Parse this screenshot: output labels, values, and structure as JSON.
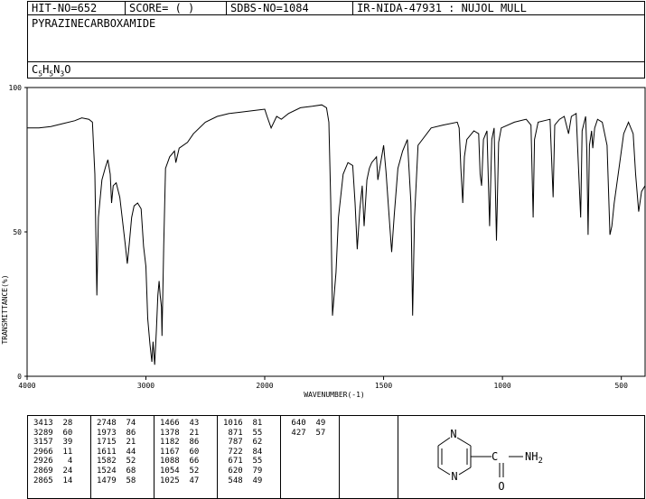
{
  "header": {
    "hit": "HIT-NO=652",
    "score": "SCORE=  (   )",
    "sdbs": "SDBS-NO=1084",
    "ir": "IR-NIDA-47931 : NUJOL MULL"
  },
  "compound": {
    "name": "PYRAZINECARBOXAMIDE",
    "formula": {
      "c": "C",
      "c_n": "5",
      "h": "H",
      "h_n": "5",
      "n": "N",
      "n_n": "3",
      "o": "O"
    }
  },
  "chart_data": {
    "type": "line",
    "xlabel": "WAVENUMBER(-1)",
    "ylabel": "TRANSMITTANCE(%)",
    "xlim": [
      4000,
      400
    ],
    "ylim": [
      0,
      100
    ],
    "xticks": [
      "4000",
      "3000",
      "2000",
      "1500",
      "1000",
      "500"
    ],
    "yticks": [
      "100",
      "50",
      "0"
    ],
    "series": [
      {
        "points": [
          [
            4000,
            86
          ],
          [
            3900,
            86
          ],
          [
            3800,
            86.5
          ],
          [
            3700,
            87.5
          ],
          [
            3600,
            88.5
          ],
          [
            3540,
            89.5
          ],
          [
            3480,
            89
          ],
          [
            3450,
            88
          ],
          [
            3430,
            70
          ],
          [
            3413,
            28
          ],
          [
            3400,
            55
          ],
          [
            3370,
            68
          ],
          [
            3340,
            72.5
          ],
          [
            3320,
            75
          ],
          [
            3300,
            70
          ],
          [
            3289,
            60
          ],
          [
            3275,
            66
          ],
          [
            3250,
            67
          ],
          [
            3220,
            62
          ],
          [
            3200,
            55
          ],
          [
            3175,
            46
          ],
          [
            3157,
            39
          ],
          [
            3140,
            46
          ],
          [
            3120,
            55
          ],
          [
            3100,
            59
          ],
          [
            3070,
            60
          ],
          [
            3040,
            58
          ],
          [
            3020,
            45
          ],
          [
            3000,
            38
          ],
          [
            2985,
            20
          ],
          [
            2966,
            11
          ],
          [
            2950,
            5
          ],
          [
            2940,
            12
          ],
          [
            2926,
            4
          ],
          [
            2912,
            16
          ],
          [
            2900,
            28
          ],
          [
            2889,
            33
          ],
          [
            2880,
            28
          ],
          [
            2869,
            24
          ],
          [
            2865,
            14
          ],
          [
            2850,
            45
          ],
          [
            2835,
            72
          ],
          [
            2800,
            76
          ],
          [
            2760,
            78
          ],
          [
            2748,
            74
          ],
          [
            2720,
            79
          ],
          [
            2650,
            81
          ],
          [
            2600,
            84
          ],
          [
            2500,
            88
          ],
          [
            2400,
            90
          ],
          [
            2300,
            91
          ],
          [
            2200,
            91.5
          ],
          [
            2100,
            92
          ],
          [
            2000,
            92.5
          ],
          [
            1990,
            90
          ],
          [
            1973,
            86
          ],
          [
            1950,
            90
          ],
          [
            1930,
            89
          ],
          [
            1900,
            91
          ],
          [
            1850,
            93
          ],
          [
            1800,
            93.5
          ],
          [
            1760,
            94
          ],
          [
            1740,
            93
          ],
          [
            1730,
            88
          ],
          [
            1722,
            60
          ],
          [
            1715,
            21
          ],
          [
            1700,
            36
          ],
          [
            1690,
            55
          ],
          [
            1670,
            70
          ],
          [
            1650,
            74
          ],
          [
            1630,
            73
          ],
          [
            1620,
            60
          ],
          [
            1611,
            44
          ],
          [
            1600,
            58
          ],
          [
            1590,
            66
          ],
          [
            1582,
            52
          ],
          [
            1570,
            68
          ],
          [
            1560,
            72
          ],
          [
            1550,
            74
          ],
          [
            1530,
            76
          ],
          [
            1524,
            68
          ],
          [
            1510,
            75
          ],
          [
            1500,
            80
          ],
          [
            1490,
            71
          ],
          [
            1479,
            58
          ],
          [
            1466,
            43
          ],
          [
            1455,
            56
          ],
          [
            1440,
            72
          ],
          [
            1420,
            78
          ],
          [
            1400,
            82
          ],
          [
            1385,
            60
          ],
          [
            1378,
            21
          ],
          [
            1370,
            55
          ],
          [
            1355,
            80
          ],
          [
            1300,
            86
          ],
          [
            1250,
            87
          ],
          [
            1190,
            88
          ],
          [
            1182,
            86
          ],
          [
            1175,
            72
          ],
          [
            1167,
            60
          ],
          [
            1160,
            76
          ],
          [
            1150,
            82
          ],
          [
            1120,
            85
          ],
          [
            1100,
            84
          ],
          [
            1094,
            70
          ],
          [
            1088,
            66
          ],
          [
            1080,
            82
          ],
          [
            1065,
            85
          ],
          [
            1054,
            52
          ],
          [
            1045,
            82
          ],
          [
            1035,
            86
          ],
          [
            1025,
            47
          ],
          [
            1016,
            81
          ],
          [
            1005,
            86
          ],
          [
            950,
            88
          ],
          [
            900,
            89
          ],
          [
            880,
            87
          ],
          [
            871,
            55
          ],
          [
            865,
            82
          ],
          [
            850,
            88
          ],
          [
            800,
            89
          ],
          [
            787,
            62
          ],
          [
            780,
            87
          ],
          [
            760,
            89
          ],
          [
            740,
            90
          ],
          [
            722,
            84
          ],
          [
            710,
            90
          ],
          [
            690,
            91
          ],
          [
            671,
            55
          ],
          [
            665,
            85
          ],
          [
            650,
            90
          ],
          [
            645,
            78
          ],
          [
            640,
            49
          ],
          [
            634,
            80
          ],
          [
            625,
            85
          ],
          [
            620,
            79
          ],
          [
            612,
            86
          ],
          [
            600,
            89
          ],
          [
            580,
            88
          ],
          [
            560,
            80
          ],
          [
            548,
            49
          ],
          [
            540,
            52
          ],
          [
            530,
            60
          ],
          [
            510,
            72
          ],
          [
            490,
            84
          ],
          [
            470,
            88
          ],
          [
            450,
            84
          ],
          [
            440,
            70
          ],
          [
            427,
            57
          ],
          [
            415,
            64
          ],
          [
            400,
            66
          ]
        ]
      }
    ]
  },
  "peaks": {
    "col1": [
      [
        "3413",
        "28"
      ],
      [
        "3289",
        "60"
      ],
      [
        "3157",
        "39"
      ],
      [
        "2966",
        "11"
      ],
      [
        "2926",
        "4"
      ],
      [
        "2869",
        "24"
      ],
      [
        "2865",
        "14"
      ]
    ],
    "col2": [
      [
        "2748",
        "74"
      ],
      [
        "1973",
        "86"
      ],
      [
        "1715",
        "21"
      ],
      [
        "1611",
        "44"
      ],
      [
        "1582",
        "52"
      ],
      [
        "1524",
        "68"
      ],
      [
        "1479",
        "58"
      ]
    ],
    "col3": [
      [
        "1466",
        "43"
      ],
      [
        "1378",
        "21"
      ],
      [
        "1182",
        "86"
      ],
      [
        "1167",
        "60"
      ],
      [
        "1088",
        "66"
      ],
      [
        "1054",
        "52"
      ],
      [
        "1025",
        "47"
      ]
    ],
    "col4": [
      [
        "1016",
        "81"
      ],
      [
        "871",
        "55"
      ],
      [
        "787",
        "62"
      ],
      [
        "722",
        "84"
      ],
      [
        "671",
        "55"
      ],
      [
        "620",
        "79"
      ],
      [
        "548",
        "49"
      ]
    ],
    "col5": [
      [
        "640",
        "49"
      ],
      [
        "427",
        "57"
      ]
    ]
  },
  "structure": {
    "atom_n1": "N",
    "atom_n2": "N",
    "atom_o": "O",
    "atom_nh2": "NH",
    "atom_nh2_sub": "2"
  }
}
